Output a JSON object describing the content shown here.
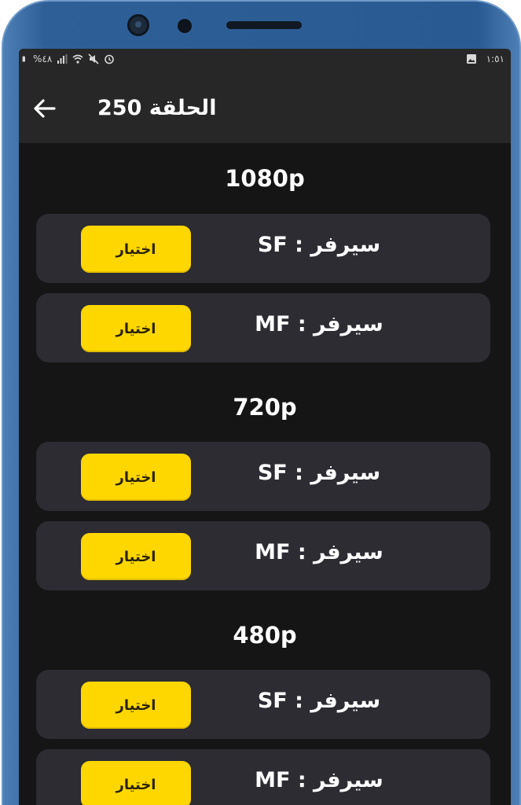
{
  "status_bar": {
    "battery_percent": "%٤٨",
    "time": "١:٥١",
    "left_icons": [
      "battery-icon",
      "signal-icon",
      "wifi-icon",
      "mute-icon",
      "alarm-icon"
    ],
    "right_icons": [
      "image-notification-icon"
    ]
  },
  "app_bar": {
    "title": "الحلقة 250",
    "back_icon": "arrow-left-icon"
  },
  "sections": [
    {
      "quality": "1080p",
      "servers": [
        {
          "label": "سيرفر : SF",
          "button": "اختيار"
        },
        {
          "label": "سيرفر : MF",
          "button": "اختيار"
        }
      ]
    },
    {
      "quality": "720p",
      "servers": [
        {
          "label": "سيرفر : SF",
          "button": "اختيار"
        },
        {
          "label": "سيرفر : MF",
          "button": "اختيار"
        }
      ]
    },
    {
      "quality": "480p",
      "servers": [
        {
          "label": "سيرفر : SF",
          "button": "اختيار"
        },
        {
          "label": "سيرفر : MF",
          "button": "اختيار"
        }
      ]
    }
  ],
  "colors": {
    "accent": "#fed700",
    "card": "#2d2c33",
    "background": "#151515",
    "app_bar": "#272727",
    "phone_frame": "#2f5f97"
  }
}
